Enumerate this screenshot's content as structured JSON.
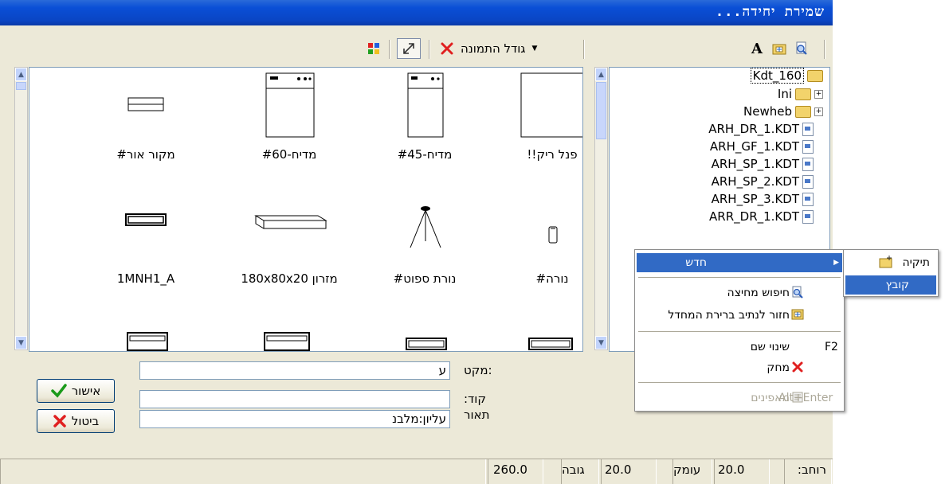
{
  "window": {
    "title": "שמירת יחידה..."
  },
  "toolbar": {
    "image_size_label": "גודל התמונה"
  },
  "gallery": {
    "items": [
      {
        "label": "#מקור אור"
      },
      {
        "label": "#מדיח-60"
      },
      {
        "label": "#מדיח-45"
      },
      {
        "label": "!!פנל ריק"
      },
      {
        "label": "1MNH1_A"
      },
      {
        "label": "180x80x20 מזרון"
      },
      {
        "label": "#נורת ספוט"
      },
      {
        "label": "#נורה"
      }
    ]
  },
  "tree": {
    "items": [
      {
        "label": "Kdt_160"
      },
      {
        "label": "Ini"
      },
      {
        "label": "Newheb"
      },
      {
        "label": "ARH_DR_1.KDT"
      },
      {
        "label": "ARH_GF_1.KDT"
      },
      {
        "label": "ARH_SP_1.KDT"
      },
      {
        "label": "ARH_SP_2.KDT"
      },
      {
        "label": "ARH_SP_3.KDT"
      },
      {
        "label": "ARR_DR_1.KDT"
      }
    ]
  },
  "form": {
    "makat_label": ":מקט",
    "makat_value": "ע",
    "code_label": "קוד:",
    "code_value": "",
    "desc_label": "תאור",
    "desc_value": "עליון:מלבנ"
  },
  "buttons": {
    "ok_label": "אישור",
    "cancel_label": "ביטול"
  },
  "status": {
    "width_label": "רוחב:",
    "width_value": "20.0",
    "depth_label": "עומק",
    "depth_value": "20.0",
    "height_label": "גובה",
    "height_value": "260.0"
  },
  "context_menu": {
    "new": "חדש",
    "find_partition": "חיפוש מחיצה",
    "back_to_default": "חזור לנתיב ברירת המחדל",
    "rename": "שינוי שם",
    "rename_shortcut": "F2",
    "delete": "מחק",
    "properties": "מאפינים",
    "properties_shortcut": "Alt+Enter"
  },
  "submenu": {
    "folder": "תיקיה",
    "file": "קובץ"
  },
  "colors": {
    "titlebar": "#0a4fd6",
    "highlight": "#316ac5",
    "delete_x": "#e02020",
    "ok_check": "#1a9a1a"
  }
}
